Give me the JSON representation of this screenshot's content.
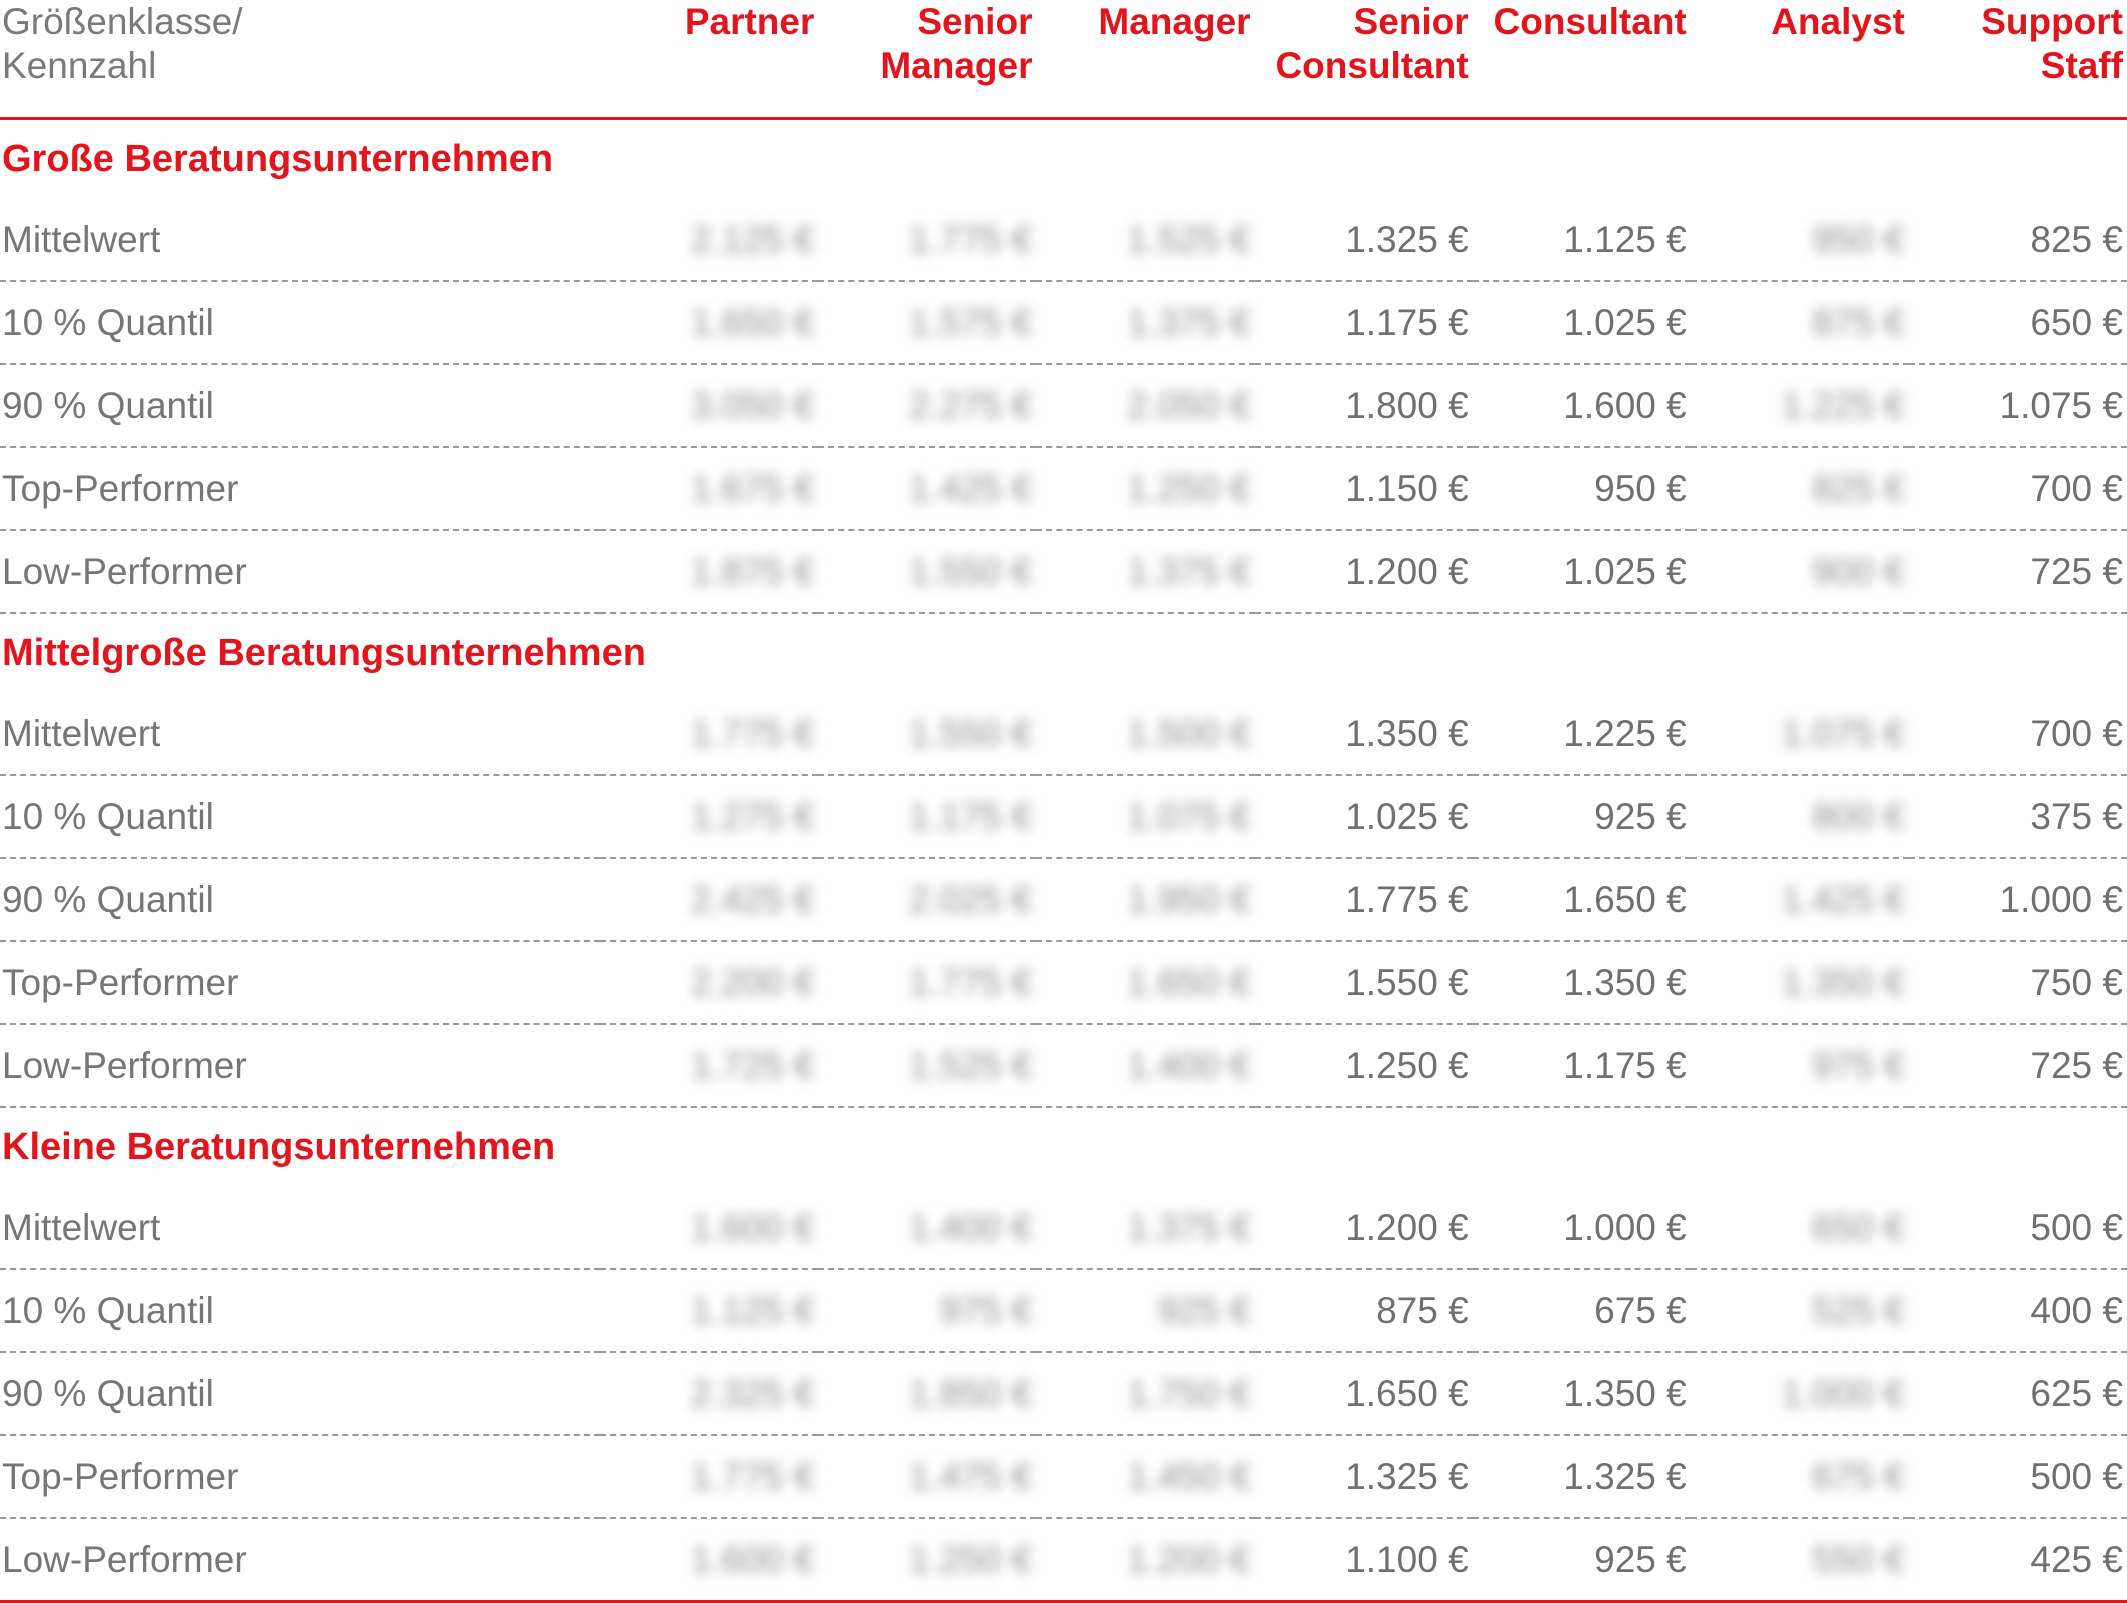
{
  "header": {
    "label": [
      "Größenklasse/",
      "Kennzahl"
    ],
    "columns": [
      [
        "Partner"
      ],
      [
        "Senior",
        "Manager"
      ],
      [
        "Manager"
      ],
      [
        "Senior",
        "Consultant"
      ],
      [
        "Consultant"
      ],
      [
        "Analyst"
      ],
      [
        "Support",
        "Staff"
      ]
    ]
  },
  "groups": [
    {
      "title": "Große Beratungsunternehmen",
      "rows": [
        {
          "label": "Mittelwert",
          "values": [
            "2.125 €",
            "1.775 €",
            "1.525 €",
            "1.325 €",
            "1.125 €",
            "950 €",
            "825 €"
          ]
        },
        {
          "label": "10 % Quantil",
          "values": [
            "1.650 €",
            "1.575 €",
            "1.375 €",
            "1.175 €",
            "1.025 €",
            "875 €",
            "650 €"
          ]
        },
        {
          "label": "90 % Quantil",
          "values": [
            "3.050 €",
            "2.275 €",
            "2.050 €",
            "1.800 €",
            "1.600 €",
            "1.225 €",
            "1.075 €"
          ]
        },
        {
          "label": "Top-Performer",
          "values": [
            "1.675 €",
            "1.425 €",
            "1.250 €",
            "1.150 €",
            "950 €",
            "825 €",
            "700 €"
          ]
        },
        {
          "label": "Low-Performer",
          "values": [
            "1.875 €",
            "1.550 €",
            "1.375 €",
            "1.200 €",
            "1.025 €",
            "900 €",
            "725 €"
          ]
        }
      ]
    },
    {
      "title": "Mittelgroße Beratungsunternehmen",
      "rows": [
        {
          "label": "Mittelwert",
          "values": [
            "1.775 €",
            "1.550 €",
            "1.500 €",
            "1.350 €",
            "1.225 €",
            "1.075 €",
            "700 €"
          ]
        },
        {
          "label": "10 % Quantil",
          "values": [
            "1.275 €",
            "1.175 €",
            "1.075 €",
            "1.025 €",
            "925 €",
            "800 €",
            "375 €"
          ]
        },
        {
          "label": "90 % Quantil",
          "values": [
            "2.425 €",
            "2.025 €",
            "1.950 €",
            "1.775 €",
            "1.650 €",
            "1.425 €",
            "1.000 €"
          ]
        },
        {
          "label": "Top-Performer",
          "values": [
            "2.200 €",
            "1.775 €",
            "1.650 €",
            "1.550 €",
            "1.350 €",
            "1.350 €",
            "750 €"
          ]
        },
        {
          "label": "Low-Performer",
          "values": [
            "1.725 €",
            "1.525 €",
            "1.400 €",
            "1.250 €",
            "1.175 €",
            "975 €",
            "725 €"
          ]
        }
      ]
    },
    {
      "title": "Kleine Beratungsunternehmen",
      "rows": [
        {
          "label": "Mittelwert",
          "values": [
            "1.600 €",
            "1.400 €",
            "1.375 €",
            "1.200 €",
            "1.000 €",
            "650 €",
            "500 €"
          ]
        },
        {
          "label": "10 % Quantil",
          "values": [
            "1.125 €",
            "975 €",
            "925 €",
            "875 €",
            "675 €",
            "525 €",
            "400 €"
          ]
        },
        {
          "label": "90 % Quantil",
          "values": [
            "2.325 €",
            "1.850 €",
            "1.750 €",
            "1.650 €",
            "1.350 €",
            "1.000 €",
            "625 €"
          ]
        },
        {
          "label": "Top-Performer",
          "values": [
            "1.775 €",
            "1.475 €",
            "1.450 €",
            "1.325 €",
            "1.325 €",
            "675 €",
            "500 €"
          ]
        },
        {
          "label": "Low-Performer",
          "values": [
            "1.600 €",
            "1.250 €",
            "1.200 €",
            "1.100 €",
            "925 €",
            "550 €",
            "425 €"
          ]
        }
      ]
    }
  ],
  "style": {
    "accent": "#e2141c",
    "text": "#707070",
    "rule": "#9a9a9a"
  }
}
